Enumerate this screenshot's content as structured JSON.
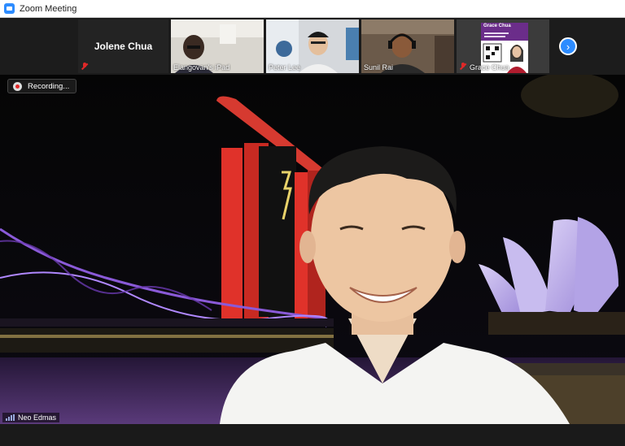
{
  "window": {
    "title": "Zoom Meeting"
  },
  "participants_strip": {
    "tiles": [
      {
        "name": "Jolene Chua",
        "video": false,
        "muted": true
      },
      {
        "name": "Elangovan's iPad",
        "video": true,
        "muted": false
      },
      {
        "name": "Peter Lee",
        "video": true,
        "muted": false
      },
      {
        "name": "Sunil Rai",
        "video": true,
        "muted": false
      },
      {
        "name": "Grace Chua",
        "video": true,
        "muted": true,
        "slide_heading": "Grace Chua"
      }
    ],
    "next_icon": "chevron-right-icon",
    "accent": "#2d8cff"
  },
  "main": {
    "recording_label": "Recording...",
    "speaker": {
      "name": "Neo Edmas"
    },
    "muted_color": "#e02828"
  }
}
